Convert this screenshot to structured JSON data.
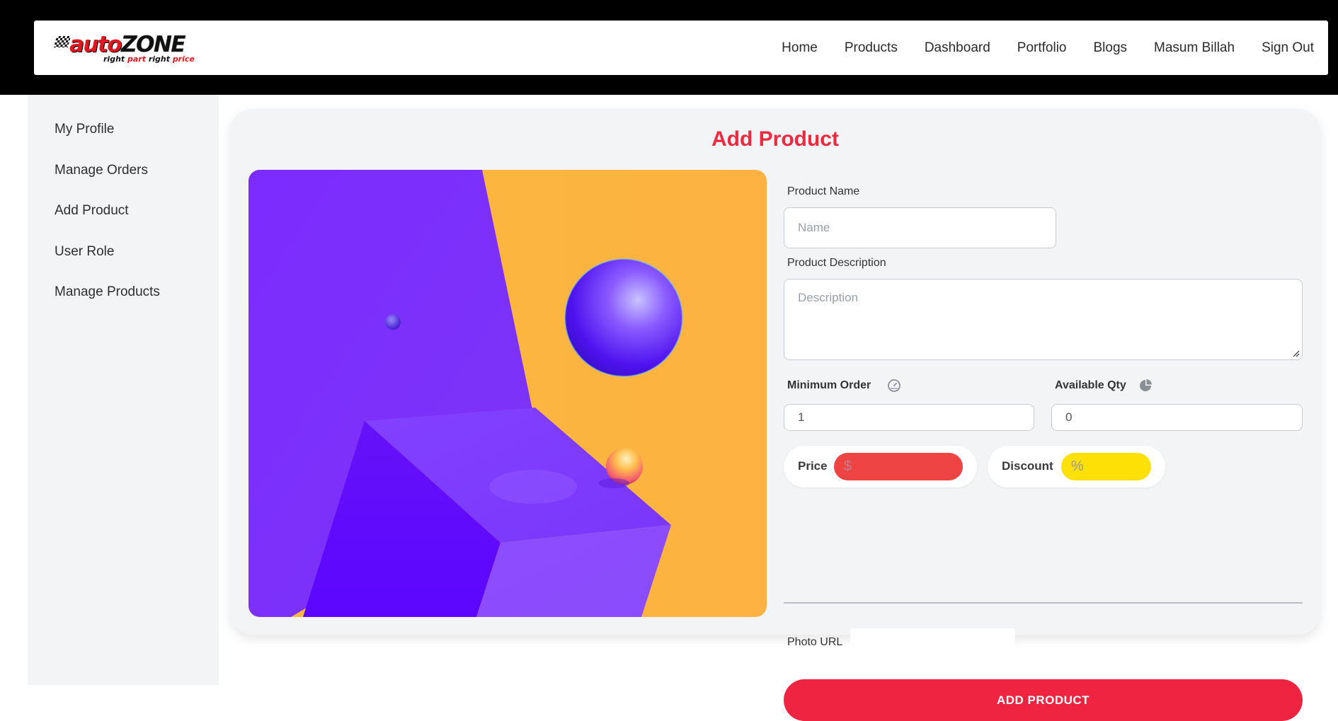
{
  "brand": {
    "logo_text_1": "auto",
    "logo_text_2": "ZONE",
    "tagline_parts": [
      "right ",
      "part",
      " right ",
      "price"
    ]
  },
  "nav": {
    "items": [
      "Home",
      "Products",
      "Dashboard",
      "Portfolio",
      "Blogs",
      "Masum Billah",
      "Sign Out"
    ]
  },
  "sidebar": {
    "items": [
      "My Profile",
      "Manage Orders",
      "Add Product",
      "User Role",
      "Manage Products"
    ]
  },
  "form": {
    "title": "Add Product",
    "product_name_label": "Product Name",
    "product_name_placeholder": "Name",
    "description_label": "Product Description",
    "description_placeholder": "Description",
    "min_order_label": "Minimum Order",
    "min_order_value": "1",
    "available_qty_label": "Available Qty",
    "available_qty_value": "0",
    "price_label": "Price",
    "price_symbol": "$",
    "discount_label": "Discount",
    "discount_symbol": "%",
    "photo_url_label": "Photo URL",
    "photo_url_value": "",
    "submit_label": "ADD PRODUCT"
  },
  "icons": {
    "min_order": "speedometer-icon",
    "available_qty": "pie-chart-icon"
  },
  "colors": {
    "accent": "#ee2440",
    "title": "#ee2940",
    "price_field": "#ef4444",
    "discount_field": "#fde006",
    "art_purple": "#7a2df8",
    "art_orange": "#fbb340"
  }
}
